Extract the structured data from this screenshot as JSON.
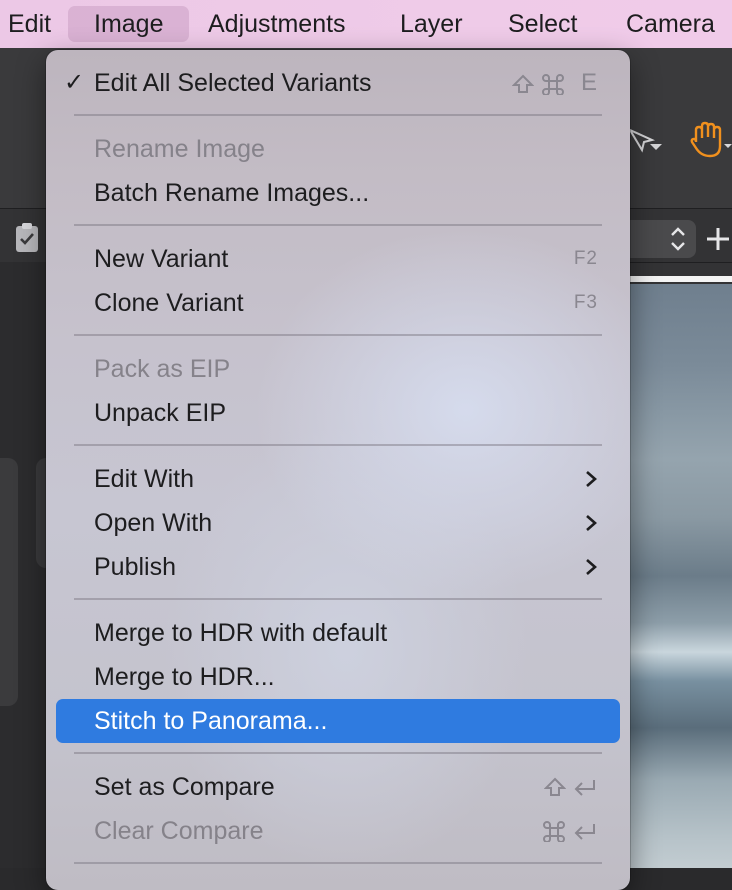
{
  "menubar": {
    "items": [
      {
        "label": "Edit"
      },
      {
        "label": "Image",
        "active": true
      },
      {
        "label": "Adjustments"
      },
      {
        "label": "Layer"
      },
      {
        "label": "Select"
      },
      {
        "label": "Camera"
      }
    ]
  },
  "image_menu": {
    "edit_all_selected_variants": {
      "label": "Edit All Selected Variants",
      "checked": true,
      "shortcut_key": "E",
      "shortcut_icons": [
        "shift-icon",
        "command-icon"
      ]
    },
    "rename_image": {
      "label": "Rename Image",
      "enabled": false
    },
    "batch_rename_images": {
      "label": "Batch Rename Images..."
    },
    "new_variant": {
      "label": "New Variant",
      "shortcut": "F2"
    },
    "clone_variant": {
      "label": "Clone Variant",
      "shortcut": "F3"
    },
    "pack_as_eip": {
      "label": "Pack as EIP",
      "enabled": false
    },
    "unpack_eip": {
      "label": "Unpack EIP"
    },
    "edit_with": {
      "label": "Edit With",
      "submenu": true
    },
    "open_with": {
      "label": "Open With",
      "submenu": true
    },
    "publish": {
      "label": "Publish",
      "submenu": true
    },
    "merge_hdr_default": {
      "label": "Merge to HDR with default"
    },
    "merge_hdr": {
      "label": "Merge to HDR..."
    },
    "stitch_panorama": {
      "label": "Stitch to Panorama...",
      "highlighted": true
    },
    "set_as_compare": {
      "label": "Set as Compare",
      "shortcut_icons": [
        "shift-icon",
        "return-icon"
      ]
    },
    "clear_compare": {
      "label": "Clear Compare",
      "enabled": false,
      "shortcut_icons": [
        "command-icon",
        "return-icon"
      ]
    }
  },
  "colors": {
    "highlight": "#2f7be0",
    "menubar_bg": "#efcbe8",
    "menubar_active": "rgba(120,60,110,0.16)",
    "disabled_text": "#85828a",
    "hand_tool_accent": "#f0901e"
  }
}
